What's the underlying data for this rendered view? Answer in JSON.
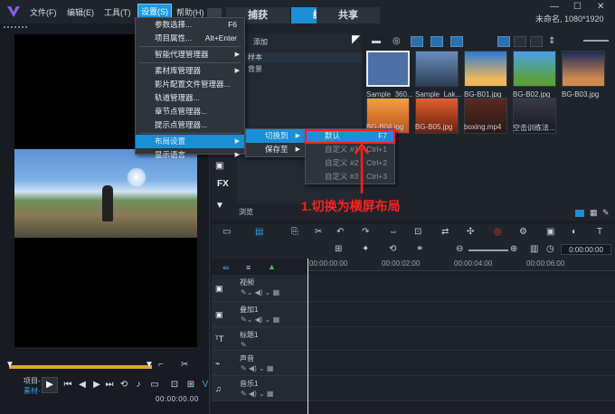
{
  "menubar": {
    "file": "文件(F)",
    "edit": "编辑(E)",
    "tools": "工具(T)",
    "settings": "设置(S)",
    "help": "帮助(H)"
  },
  "tabs": {
    "capture": "捕获",
    "edit": "编辑",
    "share": "共享"
  },
  "project_info": "未命名, 1080*1920",
  "settings_menu": {
    "items": [
      {
        "label": "参数选择...",
        "shortcut": "F6"
      },
      {
        "label": "项目属性...",
        "shortcut": "Alt+Enter"
      },
      {
        "label": "智能代理管理器"
      },
      {
        "label": "素材库管理器"
      },
      {
        "label": "影片配置文件管理器..."
      },
      {
        "label": "轨道管理器..."
      },
      {
        "label": "章节点管理器..."
      },
      {
        "label": "提示点管理器..."
      },
      {
        "label": "布局设置"
      },
      {
        "label": "显示语言"
      }
    ]
  },
  "layout_submenu": {
    "switch_to": "切换到",
    "save_to": "保存至"
  },
  "switch_submenu": {
    "items": [
      {
        "label": "默认",
        "shortcut": "F7"
      },
      {
        "label": "自定义 #1",
        "shortcut": "Ctrl+1"
      },
      {
        "label": "自定义 #2",
        "shortcut": "Ctrl+2"
      },
      {
        "label": "自定义 #3",
        "shortcut": "Ctrl+3"
      }
    ]
  },
  "library": {
    "add_label": "添加",
    "folders": [
      "样本",
      "背景"
    ],
    "browse_label": "浏览",
    "fx_label": "FX",
    "thumbnails": [
      {
        "label": "Sample_360..."
      },
      {
        "label": "Sample_Lak..."
      },
      {
        "label": "BG-B01.jpg"
      },
      {
        "label": "BG-B02.jpg"
      },
      {
        "label": "BG-B03.jpg"
      },
      {
        "label": "BG-B04.jpg"
      },
      {
        "label": "BG-B05.jpg"
      },
      {
        "label": "boxing.mp4"
      },
      {
        "label": "空击训练法..."
      }
    ]
  },
  "annotation": "1.切换为横屏布局",
  "player": {
    "project_label": "项目-",
    "clip_label": "素材-",
    "timecode": "00:00:00.00"
  },
  "timeline": {
    "timecode": "0:00:00:00",
    "ruler": [
      "00:00:00:00",
      "00:00:02:00",
      "00:00:04:00",
      "00:00:06:00"
    ],
    "tracks": [
      {
        "name": "视频"
      },
      {
        "name": "叠加1"
      },
      {
        "name": "标题1"
      },
      {
        "name": "声音"
      },
      {
        "name": "音乐1"
      }
    ]
  },
  "colors": {
    "accent": "#1a8fd6",
    "annotation": "#ff2020"
  }
}
